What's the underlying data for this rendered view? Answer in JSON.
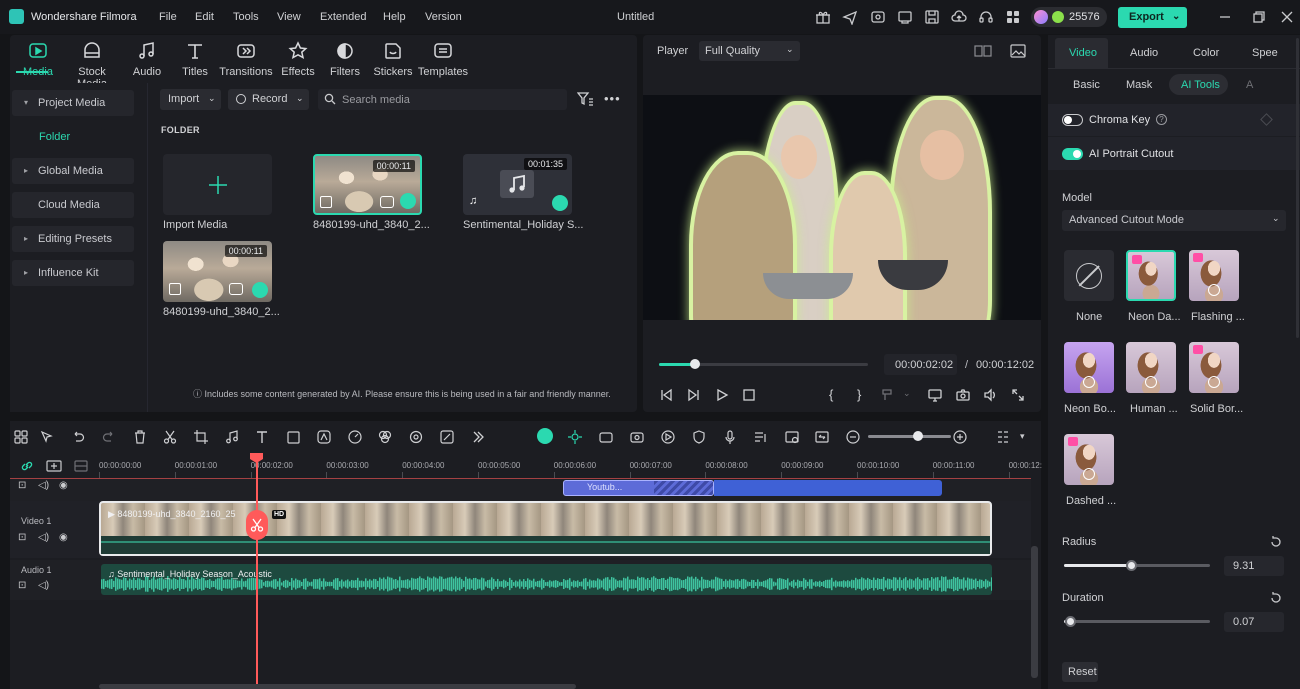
{
  "app": {
    "name": "Wondershare Filmora",
    "document_title": "Untitled",
    "credits": "25576",
    "export_label": "Export"
  },
  "menu": [
    "File",
    "Edit",
    "Tools",
    "View",
    "Extended",
    "Help",
    "Version"
  ],
  "media_tabs": [
    "Media",
    "Stock Media",
    "Audio",
    "Titles",
    "Transitions",
    "Effects",
    "Filters",
    "Stickers",
    "Templates"
  ],
  "media_sidebar": {
    "project_media": "Project Media",
    "folder": "Folder",
    "global_media": "Global Media",
    "cloud_media": "Cloud Media",
    "editing_presets": "Editing Presets",
    "influence_kit": "Influence Kit"
  },
  "media_toolbar": {
    "import": "Import",
    "record": "Record",
    "search_placeholder": "Search media"
  },
  "folder_heading": "FOLDER",
  "media_items": [
    {
      "name": "Import Media"
    },
    {
      "name": "8480199-uhd_3840_2...",
      "duration": "00:00:11"
    },
    {
      "name": "Sentimental_Holiday S...",
      "duration": "00:01:35"
    },
    {
      "name": "8480199-uhd_3840_2...",
      "duration": "00:00:11"
    }
  ],
  "ai_note": "Includes some content generated by AI. Please ensure this is being used in a fair and friendly manner.",
  "player": {
    "label": "Player",
    "quality": "Full Quality",
    "current_time": "00:00:02:02",
    "separator": "/",
    "total_time": "00:00:12:02",
    "progress": 0.17
  },
  "inspector": {
    "tabs": [
      "Video",
      "Audio",
      "Color",
      "Spee"
    ],
    "subtabs": [
      "Basic",
      "Mask",
      "AI Tools",
      "A"
    ],
    "chroma_key": "Chroma Key",
    "portrait_cutout": "AI Portrait Cutout",
    "model_label": "Model",
    "model_value": "Advanced Cutout Mode",
    "presets": [
      "None",
      "Neon Da...",
      "Flashing ...",
      "Neon Bo...",
      "Human ...",
      "Solid Bor...",
      "Dashed ..."
    ],
    "radius_label": "Radius",
    "radius_value": "9.31",
    "radius_fraction": 0.46,
    "duration_label": "Duration",
    "duration_value": "0.07",
    "duration_fraction": 0.04,
    "reset": "Reset"
  },
  "timeline": {
    "ticks": [
      "00:00:00:00",
      "00:00:01:00",
      "00:00:02:00",
      "00:00:03:00",
      "00:00:04:00",
      "00:00:05:00",
      "00:00:06:00",
      "00:00:07:00",
      "00:00:08:00",
      "00:00:09:00",
      "00:00:10:00",
      "00:00:11:00",
      "00:00:12:"
    ],
    "tracks": {
      "video": "Video 1",
      "audio": "Audio 1"
    },
    "video_clip": "8480199-uhd_3840_2160_25",
    "title_clip": "Youtub...",
    "audio_clip": "Sentimental_Holiday Season_Acoustic",
    "hd_badge": "HD"
  },
  "colors": {
    "accent": "#2bd9b0",
    "playhead": "#ff5a5a",
    "title_clip": "#5d6bd8",
    "audio_clip": "#1d4a3f"
  }
}
